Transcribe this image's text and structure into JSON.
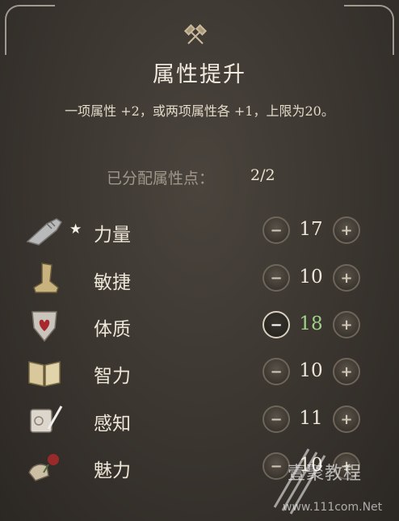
{
  "panel": {
    "title": "属性提升",
    "rule_text": "一项属性 +2，或两项属性各 +1，上限为20。",
    "points_label": "已分配属性点：",
    "points_value": "2/2"
  },
  "attributes": [
    {
      "name": "力量",
      "value": "17",
      "favored": "★",
      "icon": "gauntlet-icon",
      "changed": false
    },
    {
      "name": "敏捷",
      "value": "10",
      "favored": "",
      "icon": "boot-icon",
      "changed": false
    },
    {
      "name": "体质",
      "value": "18",
      "favored": "",
      "icon": "shield-heart-icon",
      "changed": true
    },
    {
      "name": "智力",
      "value": "10",
      "favored": "",
      "icon": "book-icon",
      "changed": false
    },
    {
      "name": "感知",
      "value": "11",
      "favored": "",
      "icon": "scroll-quill-icon",
      "changed": false
    },
    {
      "name": "魅力",
      "value": "10",
      "favored": "",
      "icon": "hand-rose-icon",
      "changed": false
    }
  ],
  "buttons": {
    "minus": "−",
    "plus": "+"
  },
  "watermark": {
    "brand": "壹聚教程",
    "url": "www.111com.Net"
  },
  "colors": {
    "changed_value": "#9fd08a",
    "background": "#3a352f",
    "text": "#eee6d8"
  }
}
